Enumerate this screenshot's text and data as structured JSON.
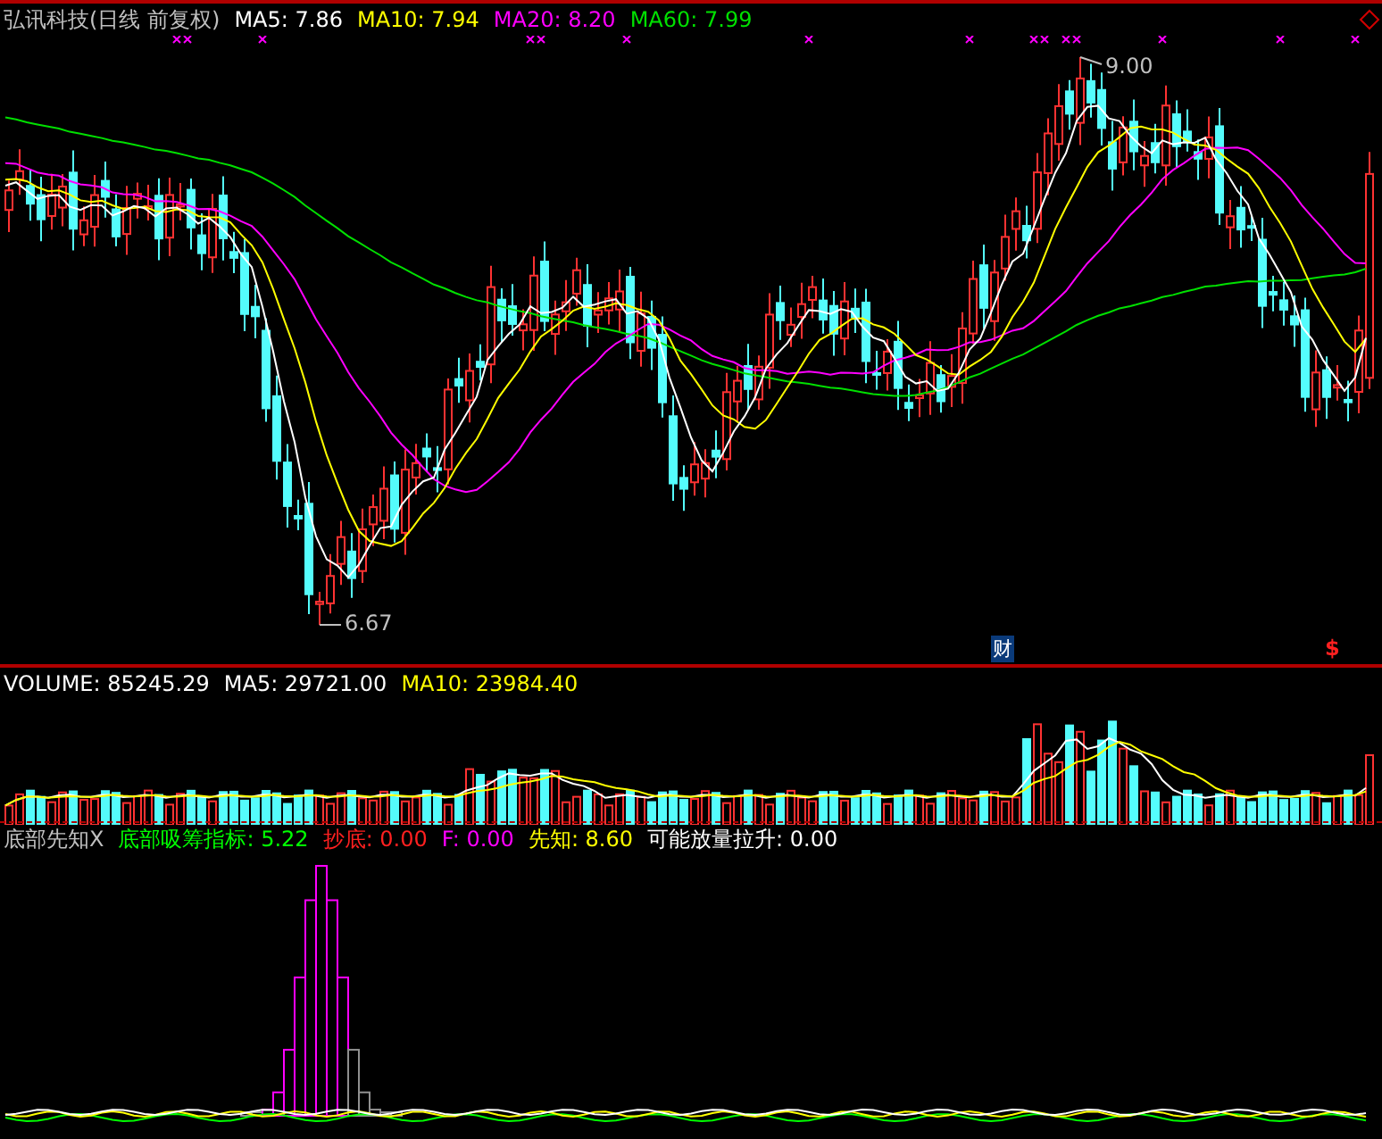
{
  "main_panel": {
    "title": "弘讯科技(日线 前复权)",
    "legend": [
      {
        "text": "MA5: 7.86",
        "color": "#ffffff"
      },
      {
        "text": "MA10: 7.94",
        "color": "#ffff00"
      },
      {
        "text": "MA20: 8.20",
        "color": "#ff00ff"
      },
      {
        "text": "MA60: 7.99",
        "color": "#00e000"
      }
    ],
    "high_label": "9.00",
    "low_label": "6.67",
    "news_badge": "财",
    "event_mark": "$"
  },
  "volume_panel": {
    "legend": [
      {
        "text": "VOLUME: 85245.29",
        "color": "#ffffff"
      },
      {
        "text": "MA5: 29721.00",
        "color": "#ffffff"
      },
      {
        "text": "MA10: 23984.40",
        "color": "#ffff00"
      }
    ]
  },
  "indicator_panel": {
    "title": "底部先知X",
    "legend": [
      {
        "text": "底部吸筹指标: 5.22",
        "color": "#00ff00"
      },
      {
        "text": "抄底: 0.00",
        "color": "#ff2020"
      },
      {
        "text": "F: 0.00",
        "color": "#ff00ff"
      },
      {
        "text": "先知: 8.60",
        "color": "#ffff00"
      },
      {
        "text": "可能放量拉升: 0.00",
        "color": "#ffffff"
      }
    ]
  }
}
